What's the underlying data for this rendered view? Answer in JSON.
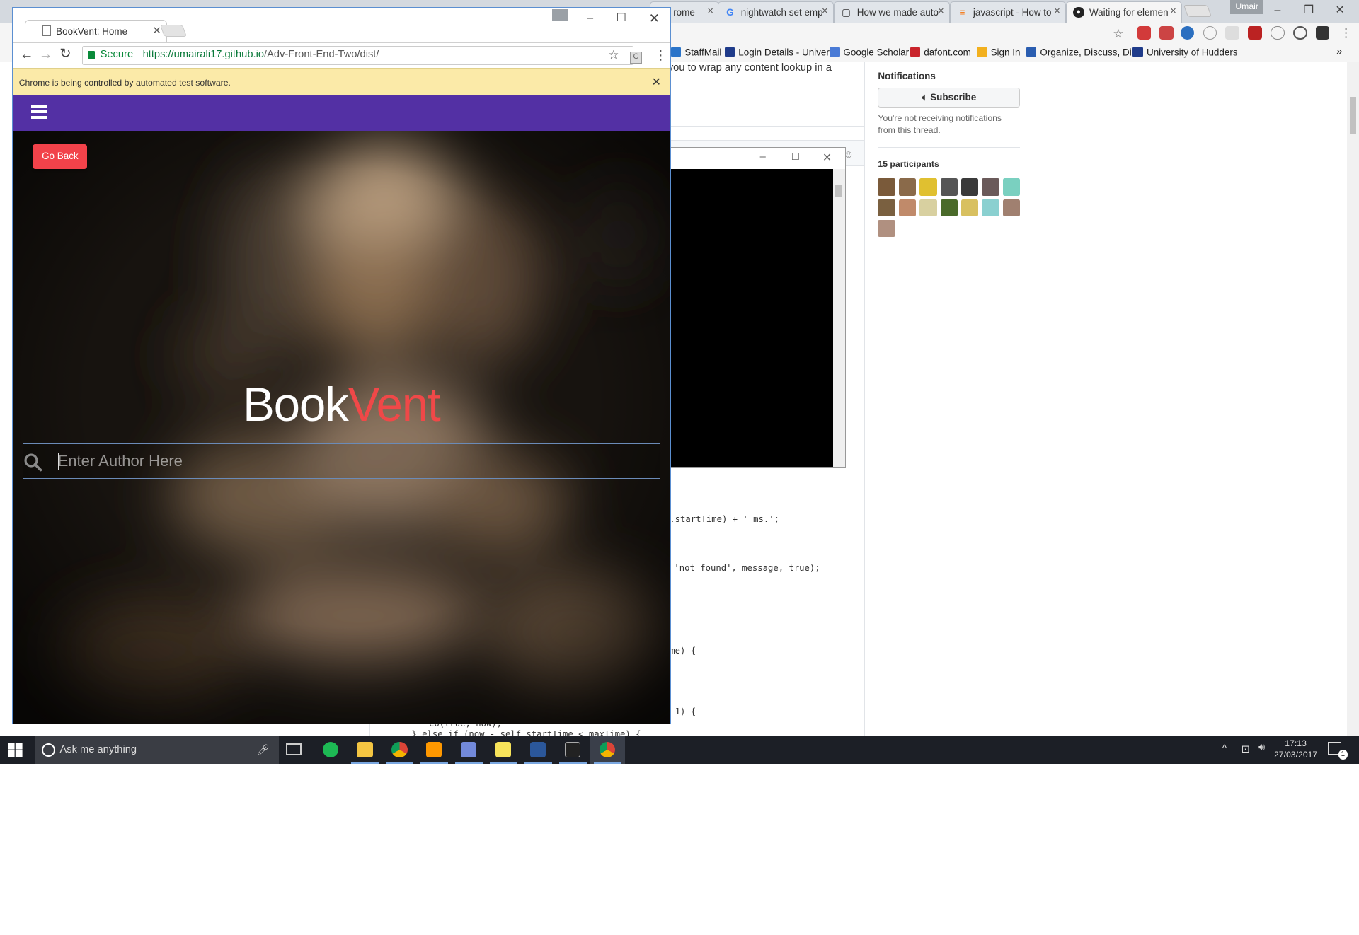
{
  "background_browser": {
    "tabs": [
      {
        "label": "rome",
        "icon": "page-icon"
      },
      {
        "label": "nightwatch set emp",
        "icon": "google-icon"
      },
      {
        "label": "How we made auto",
        "icon": "page-icon"
      },
      {
        "label": "javascript - How to",
        "icon": "stackoverflow-icon"
      },
      {
        "label": "Waiting for elemen",
        "icon": "github-icon",
        "active": true
      }
    ],
    "user_badge": "Umair",
    "bookmarks": [
      {
        "label": "StaffMail",
        "color": "#2a74c9"
      },
      {
        "label": "Login Details - Univer",
        "color": "#1f3b8a"
      },
      {
        "label": "Google Scholar",
        "color": "#4a7bd6"
      },
      {
        "label": "dafont.com",
        "color": "#c9242b"
      },
      {
        "label": "Sign In",
        "color": "#f2b01e"
      },
      {
        "label": "Organize, Discuss, Dis",
        "color": "#2a5db0"
      },
      {
        "label": "University of Hudders",
        "color": "#1f3b8a"
      }
    ],
    "github": {
      "snippet_line": "g you to wrap any content lookup in a",
      "notifications_heading": "Notifications",
      "subscribe_label": "Subscribe",
      "notifications_note": "You're not receiving notifications from this thread.",
      "participants_label": "15 participants",
      "avatar_colors": [
        "#7a5a3a",
        "#8a6a4a",
        "#e0c030",
        "#555",
        "#3a3a3a",
        "#6a5a5a",
        "#7ad0c0",
        "#7a6040",
        "#c08a6a",
        "#d8d0a0",
        "#4a6a2a",
        "#d8c060",
        "#8ad0d0",
        "#a08070",
        "#b09080"
      ],
      "code_lines": [
        ".startTime) + ' ms.';",
        "'not found', message, true);",
        "me) {",
        "-1) {",
        "  cb(true, now);",
        "} else if (now - self.startTime < maxTime) {"
      ]
    }
  },
  "browser": {
    "tab_title": "BookVent: Home",
    "secure_label": "Secure",
    "url_host": "https://umairali17.github.io",
    "url_path": "/Adv-Front-End-Two/dist/",
    "infobar_text": "Chrome is being controlled by automated test software.",
    "extension_letter": "C"
  },
  "app": {
    "nav_color": "#5330a4",
    "go_back_label": "Go Back",
    "brand_part1": "Book",
    "brand_part2": "Vent",
    "brand_accent": "#f04848",
    "search_placeholder": "Enter Author Here"
  },
  "taskbar": {
    "search_placeholder": "Ask me anything",
    "time": "17:13",
    "date": "27/03/2017",
    "notification_count": "1",
    "apps": [
      "spotify-icon",
      "file-explorer-icon",
      "chrome-icon",
      "sublime-icon",
      "discord-icon",
      "sticky-notes-icon",
      "word-icon",
      "terminal-icon",
      "chrome-active-icon"
    ]
  }
}
